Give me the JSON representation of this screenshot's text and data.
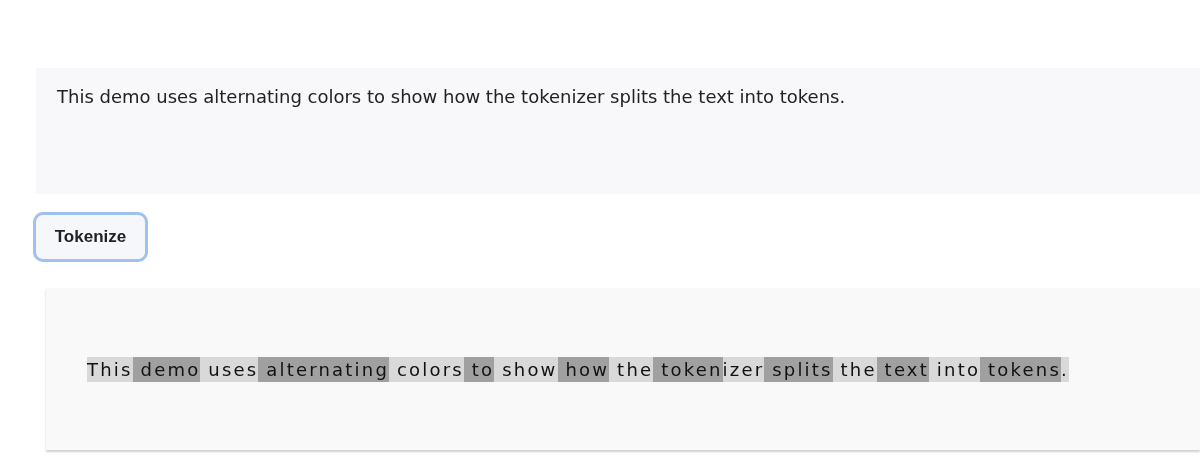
{
  "input": {
    "value": "This demo uses alternating colors to show how the tokenizer splits the text into tokens."
  },
  "button": {
    "label": "Tokenize"
  },
  "output": {
    "tokens": [
      {
        "text": "This",
        "color": "#d9d9d9"
      },
      {
        "text": " demo",
        "color": "#a0a0a0"
      },
      {
        "text": " uses",
        "color": "#d9d9d9"
      },
      {
        "text": " alternating",
        "color": "#a0a0a0"
      },
      {
        "text": " colors",
        "color": "#d9d9d9"
      },
      {
        "text": " to",
        "color": "#a0a0a0"
      },
      {
        "text": " show",
        "color": "#d9d9d9"
      },
      {
        "text": " how",
        "color": "#a0a0a0"
      },
      {
        "text": " the",
        "color": "#d9d9d9"
      },
      {
        "text": " token",
        "color": "#a0a0a0"
      },
      {
        "text": "izer",
        "color": "#d9d9d9"
      },
      {
        "text": " splits",
        "color": "#a0a0a0"
      },
      {
        "text": " the",
        "color": "#d9d9d9"
      },
      {
        "text": " text",
        "color": "#a0a0a0"
      },
      {
        "text": " into",
        "color": "#d9d9d9"
      },
      {
        "text": " tokens",
        "color": "#a0a0a0"
      },
      {
        "text": ".",
        "color": "#d9d9d9"
      }
    ]
  }
}
